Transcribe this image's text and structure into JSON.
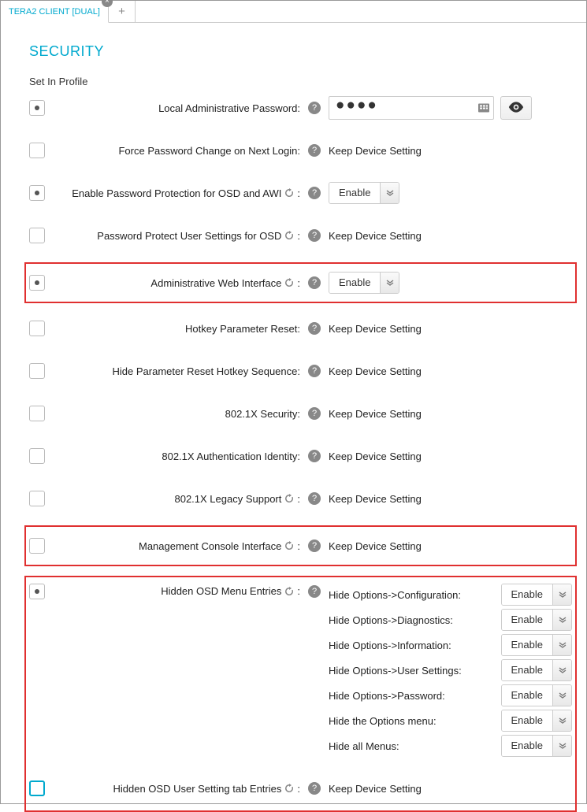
{
  "tabs": {
    "main": "TERA2 CLIENT [DUAL]"
  },
  "page": {
    "title": "SECURITY",
    "section_label": "Set In Profile"
  },
  "keep_text": "Keep Device Setting",
  "enable_text": "Enable",
  "rows": {
    "pw_label": "Local Administrative Password:",
    "pw_value": "●●●●",
    "force_pw_change": "Force Password Change on Next Login:",
    "enable_pw_protect": "Enable Password Protection for OSD and AWI",
    "pw_protect_user": "Password Protect User Settings for OSD",
    "admin_web": "Administrative Web Interface",
    "hotkey_reset": "Hotkey Parameter Reset:",
    "hide_reset_seq": "Hide Parameter Reset Hotkey Sequence:",
    "dot1x_sec": "802.1X Security:",
    "dot1x_auth": "802.1X Authentication Identity:",
    "dot1x_legacy": "802.1X Legacy Support",
    "mc_interface": "Management Console Interface",
    "hidden_osd_menu": "Hidden OSD Menu Entries",
    "hidden_osd_user": "Hidden OSD User Setting tab Entries"
  },
  "osd_sub": {
    "cfg": "Hide Options->Configuration:",
    "diag": "Hide Options->Diagnostics:",
    "info": "Hide Options->Information:",
    "user": "Hide Options->User Settings:",
    "pw": "Hide Options->Password:",
    "opt_menu": "Hide the Options menu:",
    "all": "Hide all Menus:"
  }
}
